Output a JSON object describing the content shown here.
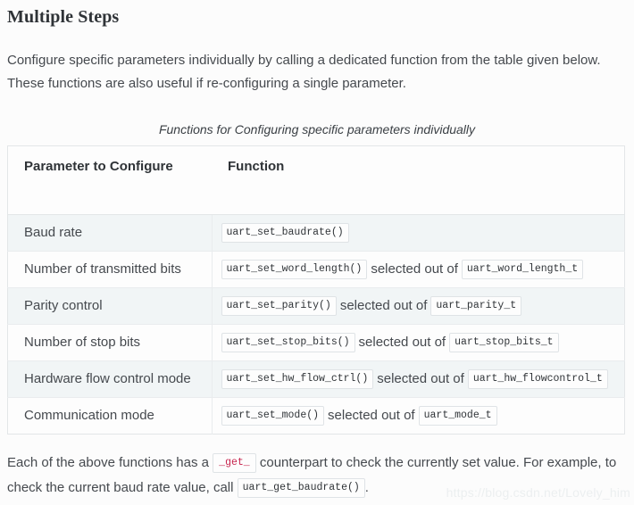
{
  "heading": "Multiple Steps",
  "intro_paragraph": "Configure specific parameters individually by calling a dedicated function from the table given below. These functions are also useful if re-configuring a single parameter.",
  "table": {
    "caption": "Functions for Configuring specific parameters individually",
    "columns": [
      "Parameter to Configure",
      "Function"
    ],
    "rows": [
      {
        "parameter": "Baud rate",
        "function": "uart_set_baudrate()",
        "connector": "",
        "type": ""
      },
      {
        "parameter": "Number of transmitted bits",
        "function": "uart_set_word_length()",
        "connector": "selected out of",
        "type": "uart_word_length_t"
      },
      {
        "parameter": "Parity control",
        "function": "uart_set_parity()",
        "connector": "selected out of",
        "type": "uart_parity_t"
      },
      {
        "parameter": "Number of stop bits",
        "function": "uart_set_stop_bits()",
        "connector": "selected out of",
        "type": "uart_stop_bits_t"
      },
      {
        "parameter": "Hardware flow control mode",
        "function": "uart_set_hw_flow_ctrl()",
        "connector": "selected out of",
        "type": "uart_hw_flowcontrol_t"
      },
      {
        "parameter": "Communication mode",
        "function": "uart_set_mode()",
        "connector": "selected out of",
        "type": "uart_mode_t"
      }
    ]
  },
  "outro": {
    "part1": "Each of the above functions has a",
    "code_get": "_get_",
    "part2": "counterpart to check the currently set value. For example, to check the current baud rate value, call",
    "code_call": "uart_get_baudrate()",
    "part3": "."
  },
  "watermark": "https://blog.csdn.net/Lovely_him",
  "colors": {
    "page_background": "#fcfcfc",
    "body_text": "#45494e",
    "heading_text": "#2f3337",
    "table_border": "#e3e6e8",
    "row_tint": "#f1f5f6",
    "row_plain": "#fdfdfd",
    "chip_border": "#dfe3e6",
    "code_red": "#c7254e",
    "watermark": "#eceff0"
  }
}
